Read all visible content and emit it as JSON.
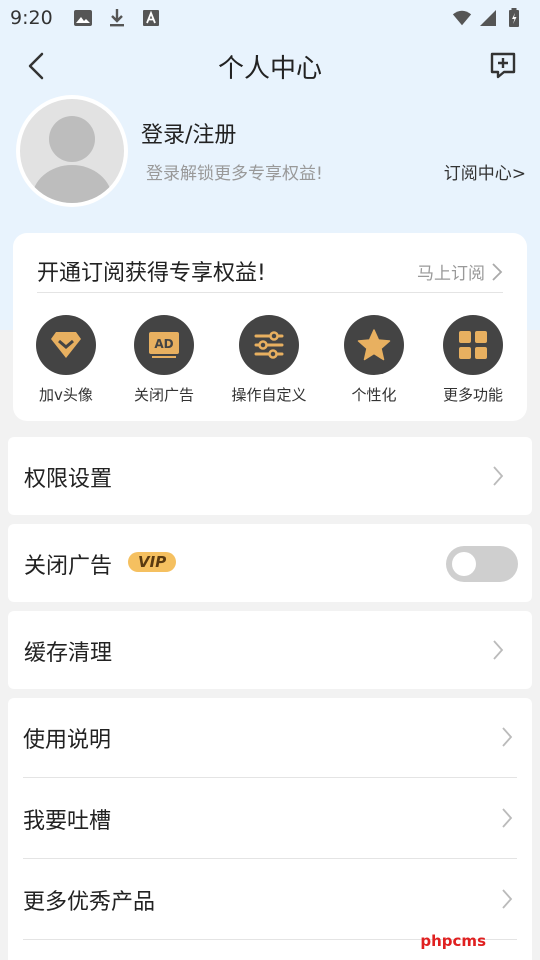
{
  "status_bar": {
    "time": "9:20",
    "icons": [
      "image-icon",
      "download-icon",
      "a-box-icon",
      "wifi-icon",
      "signal-icon",
      "battery-icon"
    ]
  },
  "header": {
    "title": "个人中心"
  },
  "profile": {
    "login": "登录/注册",
    "subtitle": "登录解锁更多专享权益!",
    "subscription_center": "订阅中心>"
  },
  "promo_card": {
    "title": "开通订阅获得专享权益!",
    "action": "马上订阅",
    "features": [
      {
        "label": "加v头像",
        "icon": "v-badge-icon"
      },
      {
        "label": "关闭广告",
        "icon": "ad-icon"
      },
      {
        "label": "操作自定义",
        "icon": "sliders-icon"
      },
      {
        "label": "个性化",
        "icon": "star-icon"
      },
      {
        "label": "更多功能",
        "icon": "grid-icon"
      }
    ]
  },
  "settings": {
    "permissions": "权限设置",
    "close_ads": "关闭广告",
    "vip_badge": "VIP",
    "close_ads_enabled": false,
    "cache": "缓存清理",
    "list": [
      {
        "label": "使用说明"
      },
      {
        "label": "我要吐槽"
      },
      {
        "label": "更多优秀产品"
      }
    ]
  },
  "watermark": "phpcms",
  "colors": {
    "accent": "#e8b060",
    "icon_bg": "#444444",
    "page_bg": "#f2f2f2",
    "header_bg": "#e8f3fd"
  }
}
